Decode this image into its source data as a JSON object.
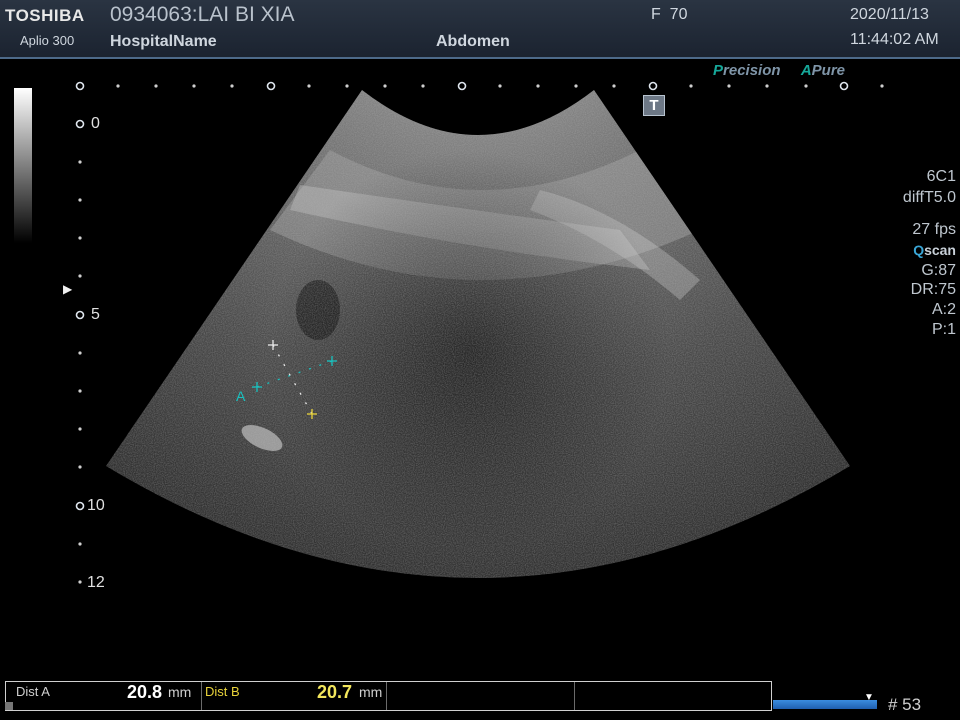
{
  "header": {
    "brand": "TOSHIBA",
    "model": "Aplio 300",
    "patient": "0934063:LAI BI XIA",
    "hospital": "HospitalName",
    "frequency": "F  70",
    "exam": "Abdomen",
    "date": "2020/11/13",
    "time": "11:44:02 AM"
  },
  "image_modes": {
    "precision_letter": "P",
    "precision_rest": "recision",
    "pure_letter": "A",
    "pure_rest": "Pure",
    "t_button": "T"
  },
  "depth_scale": {
    "label_0": "0",
    "label_5": "5",
    "label_10": "10",
    "label_12": "12"
  },
  "focus_marker": "▶",
  "params": {
    "probe": "6C1",
    "mode": "diffT5.0",
    "fps": "27 fps",
    "qscan_q": "Q",
    "qscan_rest": "scan",
    "gain": "G:87",
    "dynamic_range": "DR:75",
    "a": "A:2",
    "p": "P:1"
  },
  "caliper_label": "A",
  "measurements": {
    "dist_a_label": "Dist A",
    "dist_a_value": "20.8",
    "dist_a_unit": "mm",
    "dist_b_label": "Dist B",
    "dist_b_value": "20.7",
    "dist_b_unit": "mm"
  },
  "cine": {
    "progress": 1.0,
    "frame": "# 53"
  },
  "colors": {
    "caliper_a": "#19c2c0",
    "caliper_b": "#e8d23a",
    "dist_b_value": "#f2e65c",
    "header_bg": "#1f2835"
  }
}
